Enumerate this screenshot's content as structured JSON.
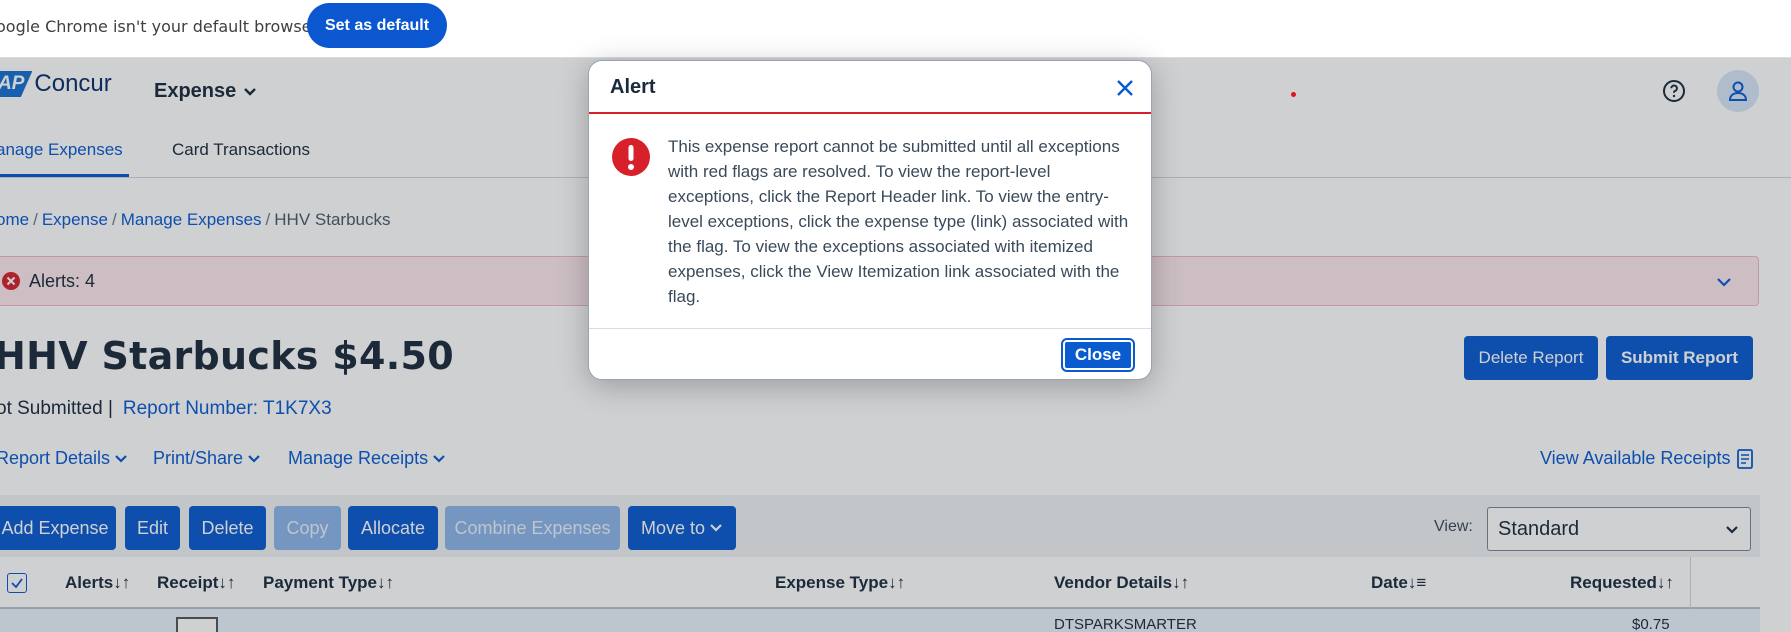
{
  "chrome_bar": {
    "message": "oogle Chrome isn't your default browser",
    "set_default_label": "Set as default"
  },
  "header": {
    "logo_sap": "AP",
    "logo_concur": "Concur",
    "nav_expense": "Expense",
    "help_icon": "help-circle-icon",
    "avatar_icon": "user-icon"
  },
  "tabs": [
    {
      "label": "anage Expenses",
      "active": true
    },
    {
      "label": "Card Transactions",
      "active": false
    }
  ],
  "breadcrumb": {
    "home": "ome",
    "expense": "Expense",
    "manage": "Manage Expenses",
    "current": "HHV Starbucks"
  },
  "alerts_bar": {
    "text": "Alerts: 4"
  },
  "report": {
    "title": "HHV Starbucks $4.50",
    "status": "ot Submitted |",
    "report_number": "Report Number: T1K7X3",
    "delete_label": "Delete Report",
    "submit_label": "Submit Report"
  },
  "menus": {
    "report_details": "Report Details",
    "print_share": "Print/Share",
    "manage_receipts": "Manage Receipts",
    "view_receipts": "View Available Receipts"
  },
  "toolbar": {
    "add_expense": "Add Expense",
    "edit": "Edit",
    "delete": "Delete",
    "copy": "Copy",
    "allocate": "Allocate",
    "combine": "Combine Expenses",
    "move_to": "Move to",
    "view_label": "View:",
    "view_value": "Standard"
  },
  "table": {
    "columns": [
      "Alerts",
      "Receipt",
      "Payment Type",
      "Expense Type",
      "Vendor Details",
      "Date",
      "Requested"
    ],
    "rows": [
      {
        "vendor": "DTSPARKSMARTER",
        "requested": "$0.75"
      }
    ]
  },
  "modal": {
    "title": "Alert",
    "body": "This expense report cannot be submitted until all exceptions with red flags are resolved. To view the report-level exceptions, click the Report Header link. To view the entry-level exceptions, click the expense type (link) associated with the flag. To view the exceptions associated with itemized expenses, click the View Itemization link associated with the flag.",
    "close_label": "Close"
  },
  "colors": {
    "brand_blue": "#0a5ad0",
    "alert_red": "#d7202a",
    "chrome_blue": "#0b57d0"
  }
}
